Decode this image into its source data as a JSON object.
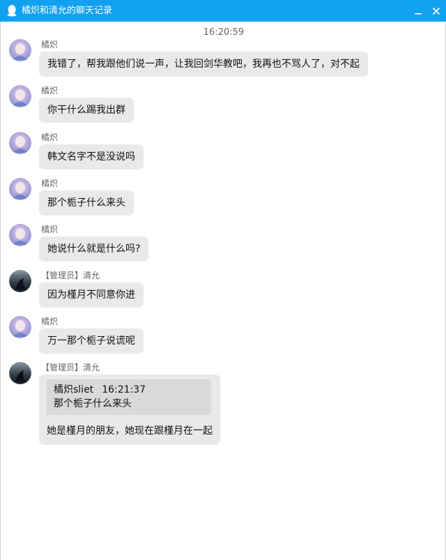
{
  "window": {
    "title": "橘炽和清允的聊天记录",
    "accent_color": "#12a0f0",
    "icon": "penguin-icon"
  },
  "controls": {
    "minimize_icon": "minimize-icon",
    "close_icon": "close-icon"
  },
  "chat": {
    "timestamp": "16:20:59",
    "messages": [
      {
        "sender": "橘炽",
        "text": "我错了，帮我跟他们说一声，让我回剑华教吧，我再也不骂人了，对不起"
      },
      {
        "sender": "橘炽",
        "text": "你干什么踢我出群"
      },
      {
        "sender": "橘炽",
        "text": "韩文名字不是没说吗"
      },
      {
        "sender": "橘炽",
        "text": "那个栀子什么来头"
      },
      {
        "sender": "橘炽",
        "text": "她说什么就是什么吗?"
      },
      {
        "sender": "【管理员】清允",
        "text": "因为槿月不同意你进"
      },
      {
        "sender": "橘炽",
        "text": "万一那个栀子说谎呢"
      },
      {
        "sender": "【管理员】清允",
        "quote": {
          "author": "橘炽sliet",
          "time": "16:21:37",
          "text": "那个栀子什么来头"
        },
        "text": "她是槿月的朋友，她现在跟槿月在一起"
      }
    ]
  }
}
